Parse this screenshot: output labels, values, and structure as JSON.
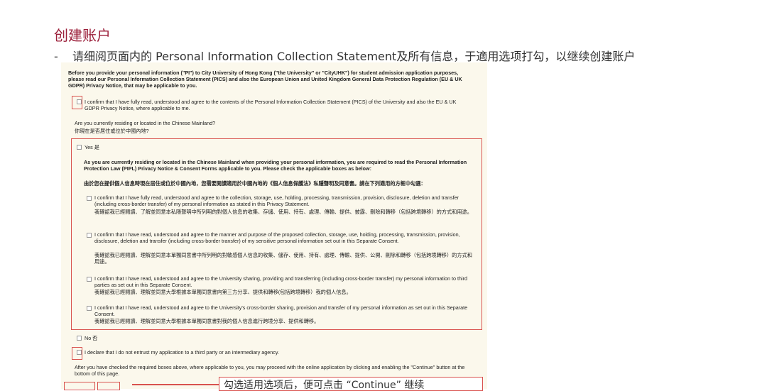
{
  "page": {
    "title": "创建账户",
    "instruction": "请细阅页面内的 Personal Information Collection Statement及所有信息，于適用选项打勾，以继续创建账户",
    "instruction_dash": "-"
  },
  "form": {
    "intro": "Before you provide your personal information (\"PI\") to City University of Hong Kong (\"the University\" or \"CityUHK\") for student admission application purposes, please read our Personal Information Collection Statement (PICS) and also the European Union and United Kingdom General Data Protection Regulation (EU & UK GDPR) Privacy Notice, that may be applicable to you.",
    "confirm_pics": "I confirm that I have fully read, understood and agree to the contents of the Personal Information Collection Statement (PICS) of the University and also the EU & UK GDPR Privacy Notice, where applicable to me.",
    "residing_question_en": "Are you currently residing or located in the Chinese Mainland?",
    "residing_question_zh": "你現在是否居住或位於中國內地?",
    "yes_label": "Yes 是",
    "pipl_notice_en": "As you are currently residing or located in the Chinese Mainland when providing your personal information, you are required to read the Personal Information Protection Law (PIPL) Privacy Notice & Consent Forms applicable to you. Please check the applicable boxes as below:",
    "pipl_notice_zh": "由於您在提供個人信息時現在居住或位於中國內地，您需要閱讀適用於中國內地的《個人信息保護法》私隱聲明及同意書。請在下列適用的方框中勾選：",
    "consents": [
      {
        "en": "I confirm that I have fully read, understood and agree to the collection, storage, use, holding, processing, transmission, provision, disclosure, deletion and transfer (including cross-border transfer) of my personal information as stated in this Privacy Statement.",
        "zh": "我確認我已經閱讀、了解並同意本私隱聲明中所列明的對個人信息的收集、存儲、使用、持有、處理、傳輸、提供、披露、刪除和轉移（包括跨境轉移）的方式和用途。"
      },
      {
        "en": "I confirm that I have read, understood and agree to the manner and purpose of the proposed collection, storage, use, holding, processing, transmission, provision, disclosure, deletion and transfer (including cross-border transfer) of my sensitive personal information set out in this Separate Consent.",
        "zh": "我確認我已經閱讀、理解並同意本單獨同意書中所列明的對敏感個人信息的收集、儲存、使用、持有、處理、傳輸、提供、公開、刪除和轉移（包括跨境轉移）的方式和用途。"
      },
      {
        "en": "I confirm that I have read, understood and agree to the University sharing, providing and transferring (including cross-border transfer) my personal information to third parties as set out in this Separate Consent.",
        "zh": "我確認我已經閱讀、理解並同意大學根據本單獨同意書向第三方分享、提供和轉移(包括跨境轉移）我的個人信息。"
      },
      {
        "en": "I confirm that I have read, understood and agree to the University's cross-border sharing, provision and transfer of my personal information as set out in this Separate Consent.",
        "zh": "我確認我已經閱讀、理解並同意大學根據本單獨同意書對我的個人信息進行跨境分享、提供和轉移。"
      }
    ],
    "no_label": "No 否",
    "declare": "I declare that I do not entrust my application to a third party or an intermediary agency.",
    "continue_note": "After you have checked the required boxes above, where applicable to you, you may proceed with the online application by clicking and enabling the \"Continue\" button at the bottom of this page."
  },
  "callout": {
    "text": "勾选适用选项后，便可点击 “Continue” 继续"
  },
  "colors": {
    "title": "#9b1f3a",
    "highlight": "#d9534f",
    "doc_bg": "#fbf8ec"
  }
}
